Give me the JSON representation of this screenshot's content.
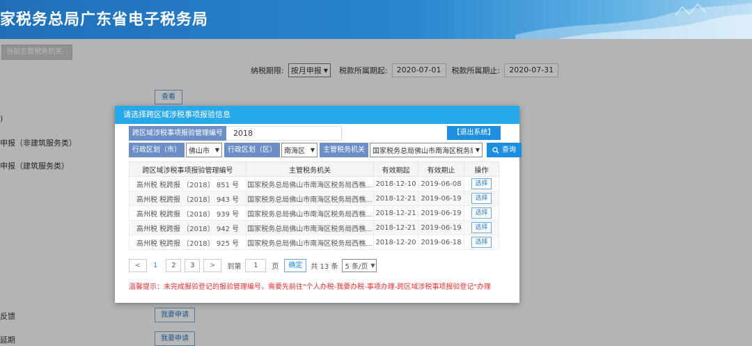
{
  "header": {
    "title": "家税务总局广东省电子税务局"
  },
  "background": {
    "tax_office_button": "当前主管税务机关:",
    "period_label": "纳税期限:",
    "period_select": "按月申报",
    "period_start_label": "税款所属期起:",
    "period_start": "2020-07-01",
    "period_end_label": "税款所属期止:",
    "period_end": "2020-07-31",
    "view_button": "查看",
    "row1": ")",
    "row2": "申报（非建筑服务类）",
    "row3": "申报（建筑服务类）",
    "row4": "反馈",
    "row5": "延期",
    "apply_button_1": "我要申请",
    "apply_button_2": "我要申请"
  },
  "modal": {
    "title": "请选择跨区域涉税事项报验信息",
    "mgmt_no_label": "跨区域涉税事项报验管理编号",
    "mgmt_no_value": "2018",
    "exit_button": "【退出系统】",
    "district_city_label": "行政区划（市）",
    "city_value": "佛山市",
    "district_area_label": "行政区划（区）",
    "area_value": "南海区",
    "tax_authority_label": "主管税务机关",
    "tax_authority_value": "国家税务总局佛山市南海区税务局西",
    "query_button": "查询",
    "table": {
      "headers": [
        "跨区域涉税事项报验管理编号",
        "主管税务机关",
        "有效期起",
        "有效期止",
        "操作"
      ],
      "rows": [
        [
          "高州税 税跨报 〔2018〕 851 号",
          "国家税务总局佛山市南海区税务局西樵...",
          "2018-12-10",
          "2019-06-08",
          "选择"
        ],
        [
          "高州税 税跨报 〔2018〕 943 号",
          "国家税务总局佛山市南海区税务局西樵...",
          "2018-12-21",
          "2019-06-19",
          "选择"
        ],
        [
          "高州税 税跨报 〔2018〕 939 号",
          "国家税务总局佛山市南海区税务局西樵...",
          "2018-12-21",
          "2019-06-19",
          "选择"
        ],
        [
          "高州税 税跨报 〔2018〕 942 号",
          "国家税务总局佛山市南海区税务局西樵...",
          "2018-12-21",
          "2019-06-19",
          "选择"
        ],
        [
          "高州税 税跨报 〔2018〕 925 号",
          "国家税务总局佛山市南海区税务局西樵...",
          "2018-12-20",
          "2019-06-18",
          "选择"
        ]
      ]
    },
    "pager": {
      "prev": "<",
      "pages": [
        "1",
        "2",
        "3"
      ],
      "next": ">",
      "goto_label": "到第",
      "goto_value": "1",
      "page_unit": "页",
      "confirm": "确定",
      "total": "共 13 条",
      "page_size": "5 条/页"
    },
    "tip": "温馨提示：未完成报验登记的报验管理编号，需要先前往\"个人办税-我要办税-事项办理-跨区域涉税事项报验登记\"办理"
  }
}
